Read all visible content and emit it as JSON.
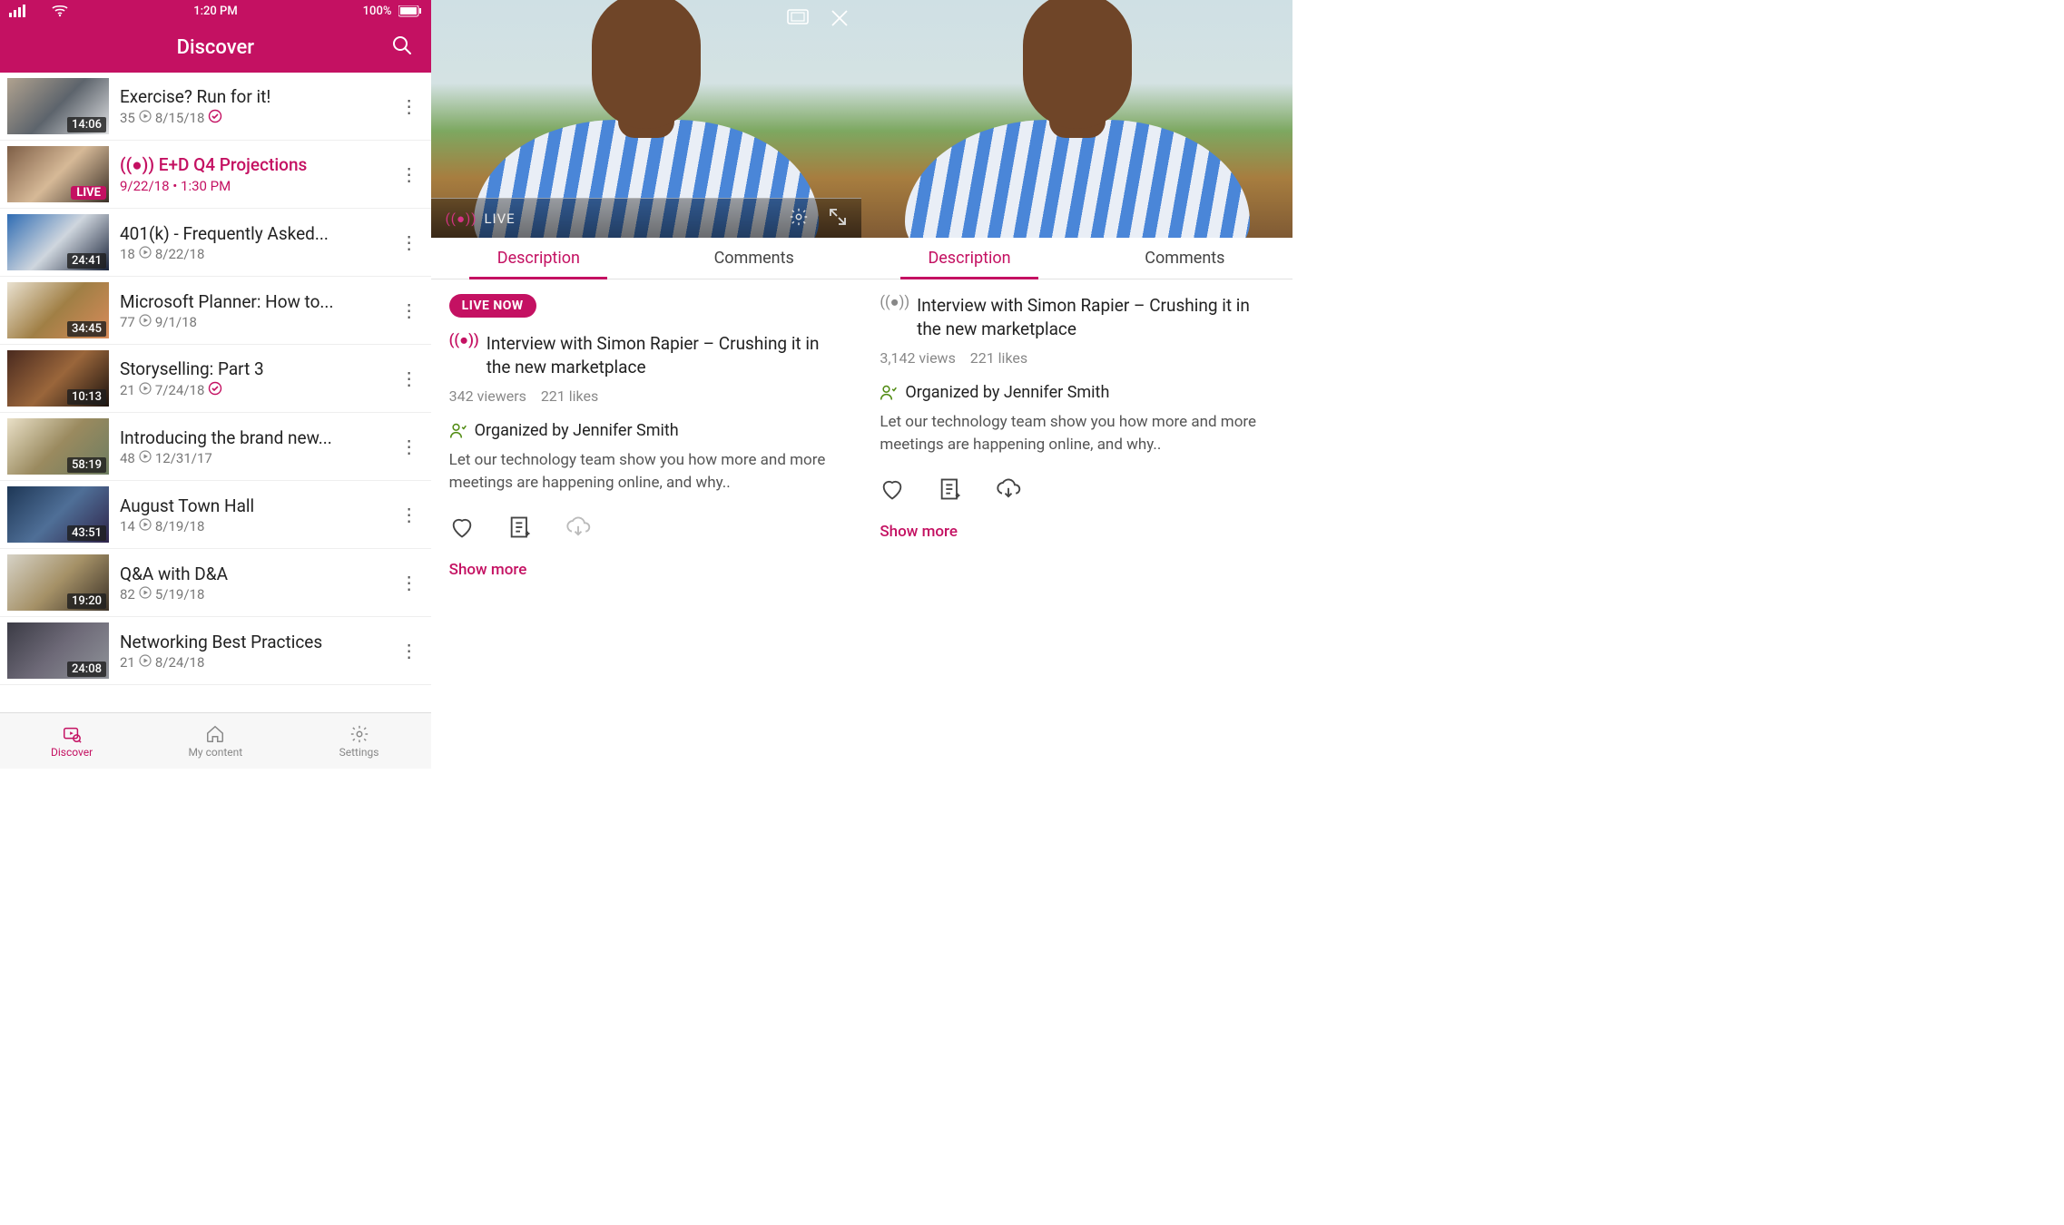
{
  "statusbar": {
    "time": "1:20 PM",
    "battery": "100%"
  },
  "header": {
    "title": "Discover"
  },
  "list": {
    "items": [
      {
        "title": "Exercise? Run for it!",
        "duration": "14:06",
        "views": "35",
        "date": "8/15/18",
        "watched": true,
        "live": false
      },
      {
        "title": "E+D Q4 Projections",
        "duration": "",
        "views": "",
        "date": "9/22/18 • 1:30 PM",
        "watched": false,
        "live": true,
        "live_label": "LIVE"
      },
      {
        "title": "401(k) - Frequently Asked...",
        "duration": "24:41",
        "views": "18",
        "date": "8/22/18",
        "watched": false,
        "live": false
      },
      {
        "title": "Microsoft Planner: How to...",
        "duration": "34:45",
        "views": "77",
        "date": "9/1/18",
        "watched": false,
        "live": false
      },
      {
        "title": "Storyselling: Part 3",
        "duration": "10:13",
        "views": "21",
        "date": "7/24/18",
        "watched": true,
        "live": false
      },
      {
        "title": "Introducing the brand new...",
        "duration": "58:19",
        "views": "48",
        "date": "12/31/17",
        "watched": false,
        "live": false
      },
      {
        "title": "August Town Hall",
        "duration": "43:51",
        "views": "14",
        "date": "8/19/18",
        "watched": false,
        "live": false
      },
      {
        "title": "Q&A with D&A",
        "duration": "19:20",
        "views": "82",
        "date": "5/19/18",
        "watched": false,
        "live": false
      },
      {
        "title": "Networking Best Practices",
        "duration": "24:08",
        "views": "21",
        "date": "8/24/18",
        "watched": false,
        "live": false
      }
    ]
  },
  "bottom_nav": {
    "discover": "Discover",
    "mycontent": "My content",
    "settings": "Settings"
  },
  "player_live": {
    "live_label": "LIVE",
    "tabs": {
      "description": "Description",
      "comments": "Comments"
    },
    "live_now": "LIVE NOW",
    "title": "Interview with Simon Rapier – Crushing it in the new marketplace",
    "viewers": "342 viewers",
    "likes": "221 likes",
    "organizer_label": "Organized by Jennifer Smith",
    "description": "Let our technology team show you how more and more meetings are happening online, and why..",
    "show_more": "Show more"
  },
  "player_vod": {
    "tabs": {
      "description": "Description",
      "comments": "Comments"
    },
    "title": "Interview with Simon Rapier – Crushing it in the new marketplace",
    "views": "3,142 views",
    "likes": "221 likes",
    "organizer_label": "Organized by Jennifer Smith",
    "description": "Let our technology team show you how more and more meetings are happening online, and why..",
    "show_more": "Show more"
  }
}
